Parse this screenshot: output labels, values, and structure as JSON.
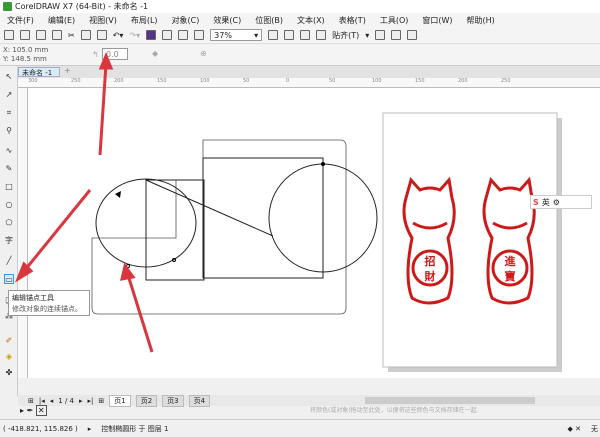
{
  "window": {
    "title": "CorelDRAW X7 (64-Bit) - 未命名 -1"
  },
  "menu": [
    "文件(F)",
    "编辑(E)",
    "视图(V)",
    "布局(L)",
    "对象(C)",
    "效果(C)",
    "位图(B)",
    "文本(X)",
    "表格(T)",
    "工具(O)",
    "窗口(W)",
    "帮助(H)"
  ],
  "toolbar": {
    "zoom": "37%",
    "snap": "贴齐(T)"
  },
  "propbar": {
    "x": "X: 105.0 mm",
    "y": "Y: 148.5 mm",
    "angle": "0.0"
  },
  "document_tab": "未命名 -1",
  "ruler_labels": [
    "300",
    "250",
    "200",
    "150",
    "100",
    "50",
    "0",
    "50",
    "100",
    "150",
    "200",
    "250"
  ],
  "tooltip": {
    "title": "编辑锚点工具",
    "desc": "修改对象的连续锚点。"
  },
  "pagenav": {
    "counter": "1 / 4",
    "pages": [
      "页1",
      "页2",
      "页3",
      "页4"
    ]
  },
  "hint": "将颜色(或对象)拖动至此处，以便将这些颜色与文档存储在一起",
  "status": {
    "coords": "( -418.821, 115.826 )",
    "message": "控制椭圆形 于 图层 1",
    "fill": "无"
  },
  "ime": {
    "label": "英"
  },
  "artwork": {
    "left_text": [
      "招",
      "財"
    ],
    "right_text": [
      "進",
      "寶"
    ],
    "color": "#cc1a1a"
  },
  "colors": {
    "arrow": "#d9363e",
    "accent": "#cc1a1a"
  }
}
